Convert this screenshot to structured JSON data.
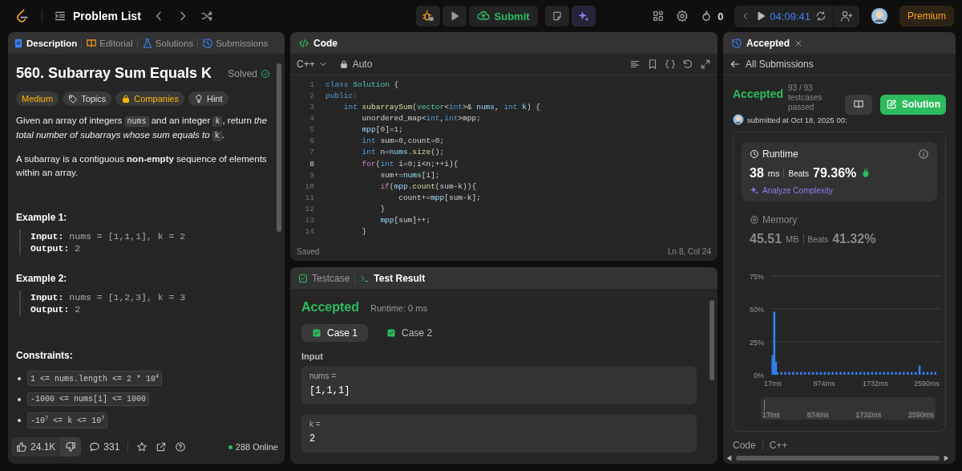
{
  "topbar": {
    "title": "Problem List",
    "submit": "Submit",
    "streak": "0",
    "timer": "04:09:41",
    "premium": "Premium"
  },
  "description_panel": {
    "tabs": [
      {
        "label": "Description",
        "kind": "description",
        "selected": true
      },
      {
        "label": "Editorial",
        "kind": "editorial",
        "selected": false
      },
      {
        "label": "Solutions",
        "kind": "solutions",
        "selected": false
      },
      {
        "label": "Submissions",
        "kind": "submissions",
        "selected": false
      }
    ],
    "title": "560. Subarray Sum Equals K",
    "status": "Solved",
    "solved": true,
    "tags": [
      {
        "label": "Medium",
        "kind": "difficulty"
      },
      {
        "label": "Topics",
        "kind": "topics"
      },
      {
        "label": "Companies",
        "kind": "companies"
      },
      {
        "label": "Hint",
        "kind": "hint"
      }
    ],
    "paragraphs": [
      [
        {
          "kind": "text",
          "text": "Given an array of integers "
        },
        {
          "kind": "code",
          "text": "nums"
        },
        {
          "kind": "text",
          "text": " and an integer "
        },
        {
          "kind": "code",
          "text": "k"
        },
        {
          "kind": "text",
          "text": ", return *the total number of subarrays whose sum equals to* "
        },
        {
          "kind": "code",
          "text": "k"
        },
        {
          "kind": "text",
          "text": "."
        }
      ],
      [
        {
          "kind": "text",
          "text": "A subarray is a contiguous **non-empty** sequence of elements within an array."
        }
      ]
    ],
    "examples": [
      {
        "heading": "Example 1:",
        "input_label": "Input:",
        "input": "nums = [1,1,1], k = 2",
        "output_label": "Output:",
        "output": "2"
      },
      {
        "heading": "Example 2:",
        "input_label": "Input:",
        "input": "nums = [1,2,3], k = 3",
        "output_label": "Output:",
        "output": "2"
      }
    ],
    "constraints_heading": "Constraints:",
    "constraints": [
      "1 <= nums.length <= 2 * 10$^{4}$",
      "-1000 <= nums[i] <= 1000",
      "-10$^{7}$ <= k <= 10$^{7}$"
    ],
    "footer": {
      "likes": "24.1K",
      "comments": "331",
      "online": "288 Online"
    }
  },
  "code_panel": {
    "title": "Code",
    "language": "C++",
    "mode": "Auto",
    "status": "Saved",
    "cursor": "Ln 8, Col 24",
    "lines": [
      {
        "number": "1",
        "current": false,
        "tokens": [
          {
            "kind": "kw",
            "text": "class"
          },
          {
            "kind": "type",
            "text": " Solution"
          },
          {
            "kind": "plain",
            "text": " {"
          }
        ]
      },
      {
        "number": "2",
        "current": false,
        "tokens": [
          {
            "kind": "kw",
            "text": "public:"
          }
        ]
      },
      {
        "number": "3",
        "current": false,
        "tokens": [
          {
            "kind": "kw",
            "text": "    int"
          },
          {
            "kind": "fn",
            "text": " subarraySum"
          },
          {
            "kind": "plain",
            "text": "("
          },
          {
            "kind": "type",
            "text": "vector"
          },
          {
            "kind": "plain",
            "text": "<"
          },
          {
            "kind": "kw",
            "text": "int"
          },
          {
            "kind": "plain",
            "text": ">& "
          },
          {
            "kind": "var",
            "text": "nums"
          },
          {
            "kind": "plain",
            "text": ", "
          },
          {
            "kind": "kw",
            "text": "int"
          },
          {
            "kind": "var",
            "text": " k"
          },
          {
            "kind": "plain",
            "text": ") {"
          }
        ]
      },
      {
        "number": "4",
        "current": false,
        "tokens": [
          {
            "kind": "plain",
            "text": "        unordered_map<"
          },
          {
            "kind": "kw",
            "text": "int"
          },
          {
            "kind": "plain",
            "text": ","
          },
          {
            "kind": "kw",
            "text": "int"
          },
          {
            "kind": "plain",
            "text": ">mpp;"
          }
        ]
      },
      {
        "number": "5",
        "current": false,
        "tokens": [
          {
            "kind": "var",
            "text": "        mpp"
          },
          {
            "kind": "plain",
            "text": "["
          },
          {
            "kind": "num",
            "text": "0"
          },
          {
            "kind": "plain",
            "text": "]="
          },
          {
            "kind": "num",
            "text": "1"
          },
          {
            "kind": "plain",
            "text": ";"
          }
        ]
      },
      {
        "number": "6",
        "current": false,
        "tokens": [
          {
            "kind": "kw",
            "text": "        int"
          },
          {
            "kind": "plain",
            "text": " sum="
          },
          {
            "kind": "num",
            "text": "0"
          },
          {
            "kind": "plain",
            "text": ",count="
          },
          {
            "kind": "num",
            "text": "0"
          },
          {
            "kind": "plain",
            "text": ";"
          }
        ]
      },
      {
        "number": "7",
        "current": false,
        "tokens": [
          {
            "kind": "kw",
            "text": "        int"
          },
          {
            "kind": "plain",
            "text": " n="
          },
          {
            "kind": "var",
            "text": "nums"
          },
          {
            "kind": "plain",
            "text": "."
          },
          {
            "kind": "fn",
            "text": "size"
          },
          {
            "kind": "plain",
            "text": "();"
          }
        ]
      },
      {
        "number": "8",
        "current": true,
        "tokens": [
          {
            "kind": "ctl",
            "text": "        for"
          },
          {
            "kind": "plain",
            "text": "("
          },
          {
            "kind": "kw",
            "text": "int"
          },
          {
            "kind": "plain",
            "text": " i="
          },
          {
            "kind": "num",
            "text": "0"
          },
          {
            "kind": "plain",
            "text": ";i<n;++i){"
          }
        ]
      },
      {
        "number": "9",
        "current": false,
        "tokens": [
          {
            "kind": "plain",
            "text": "            sum+="
          },
          {
            "kind": "var",
            "text": "nums"
          },
          {
            "kind": "plain",
            "text": "[i];"
          }
        ]
      },
      {
        "number": "10",
        "current": false,
        "tokens": [
          {
            "kind": "ctl",
            "text": "            if"
          },
          {
            "kind": "plain",
            "text": "("
          },
          {
            "kind": "var",
            "text": "mpp"
          },
          {
            "kind": "plain",
            "text": "."
          },
          {
            "kind": "fn",
            "text": "count"
          },
          {
            "kind": "plain",
            "text": "(sum-k)){"
          }
        ]
      },
      {
        "number": "11",
        "current": false,
        "tokens": [
          {
            "kind": "plain",
            "text": "                count+="
          },
          {
            "kind": "var",
            "text": "mpp"
          },
          {
            "kind": "plain",
            "text": "[sum-k];"
          }
        ]
      },
      {
        "number": "12",
        "current": false,
        "tokens": [
          {
            "kind": "plain",
            "text": "            }"
          }
        ]
      },
      {
        "number": "13",
        "current": false,
        "tokens": [
          {
            "kind": "var",
            "text": "            mpp"
          },
          {
            "kind": "plain",
            "text": "[sum]++;"
          }
        ]
      },
      {
        "number": "14",
        "current": false,
        "tokens": [
          {
            "kind": "plain",
            "text": "        }"
          }
        ]
      }
    ]
  },
  "test_panel": {
    "tabs": [
      {
        "label": "Testcase",
        "kind": "testcase",
        "selected": false
      },
      {
        "label": "Test Result",
        "kind": "result",
        "selected": true
      }
    ],
    "verdict": "Accepted",
    "runtime": "Runtime: 0 ms",
    "cases": [
      {
        "label": "Case 1",
        "selected": true,
        "passed": true
      },
      {
        "label": "Case 2",
        "selected": false,
        "passed": true
      }
    ],
    "input_heading": "Input",
    "inputs": [
      {
        "name": "nums =",
        "value": "[1,1,1]"
      },
      {
        "name": "k =",
        "value": "2"
      }
    ]
  },
  "submission_panel": {
    "tab": "Accepted",
    "back": "All Submissions",
    "verdict": "Accepted",
    "testcases": "93 / 93 testcases passed",
    "submitted": "submitted at Oct 18, 2025 00:",
    "solution_button": "Solution",
    "runtime": {
      "label": "Runtime",
      "value": "38",
      "unit": "ms",
      "beats_label": "Beats",
      "beats": "79.36%",
      "analyze": "Analyze Complexity",
      "selected": true
    },
    "memory": {
      "label": "Memory",
      "value": "45.51",
      "unit": "MB",
      "beats_label": "Beats",
      "beats": "41.32%",
      "selected": false
    },
    "chart_data": {
      "type": "bar",
      "xlim": [
        -23,
        2818
      ],
      "ylim": [
        0,
        75
      ],
      "grid": true,
      "x": [
        10,
        38,
        66,
        90,
        156,
        222,
        288,
        354,
        420,
        486,
        552,
        618,
        684,
        750,
        816,
        882,
        948,
        1014,
        1080,
        1146,
        1212,
        1278,
        1344,
        1410,
        1476,
        1542,
        1608,
        1674,
        1740,
        1806,
        1872,
        1938,
        2004,
        2070,
        2136,
        2202,
        2268,
        2334,
        2400,
        2466,
        2532,
        2598,
        2664,
        2730
      ],
      "values": [
        15,
        48,
        10,
        2,
        2,
        2,
        2,
        2,
        2,
        2,
        2,
        2,
        2,
        2,
        2,
        2,
        2,
        2,
        2,
        2,
        2,
        2,
        2,
        2,
        2,
        2,
        2,
        2,
        2,
        2,
        2,
        2,
        2,
        2,
        2,
        2,
        2,
        2,
        2,
        7,
        2,
        2,
        2,
        2
      ],
      "yticks": [
        {
          "value": 0,
          "label": "0%"
        },
        {
          "value": 25,
          "label": "25%"
        },
        {
          "value": 50,
          "label": "50%"
        },
        {
          "value": 75,
          "label": "75%"
        }
      ],
      "xticks": [
        {
          "value": 17,
          "label": "17ms"
        },
        {
          "value": 874,
          "label": "874ms"
        },
        {
          "value": 1732,
          "label": "1732ms"
        },
        {
          "value": 2590,
          "label": "2590ms"
        }
      ]
    },
    "navigator_labels": [
      "17ms",
      "874ms",
      "1732ms",
      "2590ms"
    ],
    "footer": {
      "code": "Code",
      "language": "C++"
    }
  }
}
